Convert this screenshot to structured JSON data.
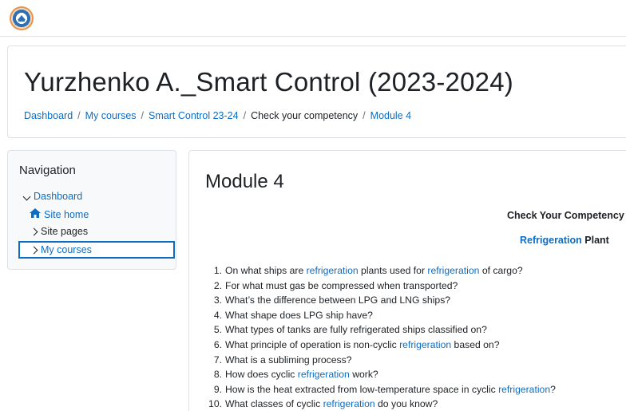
{
  "course": {
    "title": "Yurzhenko A._Smart Control (2023-2024)"
  },
  "breadcrumb": {
    "items": [
      "Dashboard",
      "My courses",
      "Smart Control 23-24",
      "Check your competency",
      "Module 4"
    ],
    "separator": "/"
  },
  "navigation": {
    "heading": "Navigation",
    "dashboard": "Dashboard",
    "site_home": "Site home",
    "site_pages": "Site pages",
    "my_courses": "My courses"
  },
  "main": {
    "title": "Module 4",
    "heading1": "Check Your Competency",
    "heading2_link": "Refrigeration",
    "heading2_rest": " Plant",
    "questions": [
      {
        "n": "1.",
        "parts": [
          "On what ships are ",
          "refrigeration",
          " plants used for ",
          "refrigeration",
          " of cargo?"
        ]
      },
      {
        "n": "2.",
        "parts": [
          "For what must gas be compressed when transported?"
        ]
      },
      {
        "n": "3.",
        "parts": [
          "What’s the difference between LPG and LNG ships?"
        ]
      },
      {
        "n": "4.",
        "parts": [
          "What shape does LPG ship have?"
        ]
      },
      {
        "n": "5.",
        "parts": [
          "What types of tanks are fully refrigerated ships classified on?"
        ]
      },
      {
        "n": "6.",
        "parts": [
          "What principle of operation is non-cyclic ",
          "refrigeration",
          " based on?"
        ]
      },
      {
        "n": "7.",
        "parts": [
          "What is a subliming process?"
        ]
      },
      {
        "n": "8.",
        "parts": [
          "How does cyclic ",
          "refrigeration",
          " work?"
        ]
      },
      {
        "n": "9.",
        "parts": [
          "How is the heat extracted from low-temperature space in cyclic ",
          "refrigeration",
          "?"
        ]
      },
      {
        "n": "10.",
        "parts": [
          "What classes of cyclic ",
          "refrigeration",
          " do you know?"
        ]
      }
    ]
  },
  "colors": {
    "link": "#0f6cbf",
    "text": "#1d2125",
    "border": "#dee2e6",
    "nav_bg": "#f8f9fa"
  },
  "icons": {
    "logo": "university-logo-icon",
    "home": "home-icon",
    "chevron_down": "chevron-down-icon",
    "chevron_right": "chevron-right-icon"
  }
}
